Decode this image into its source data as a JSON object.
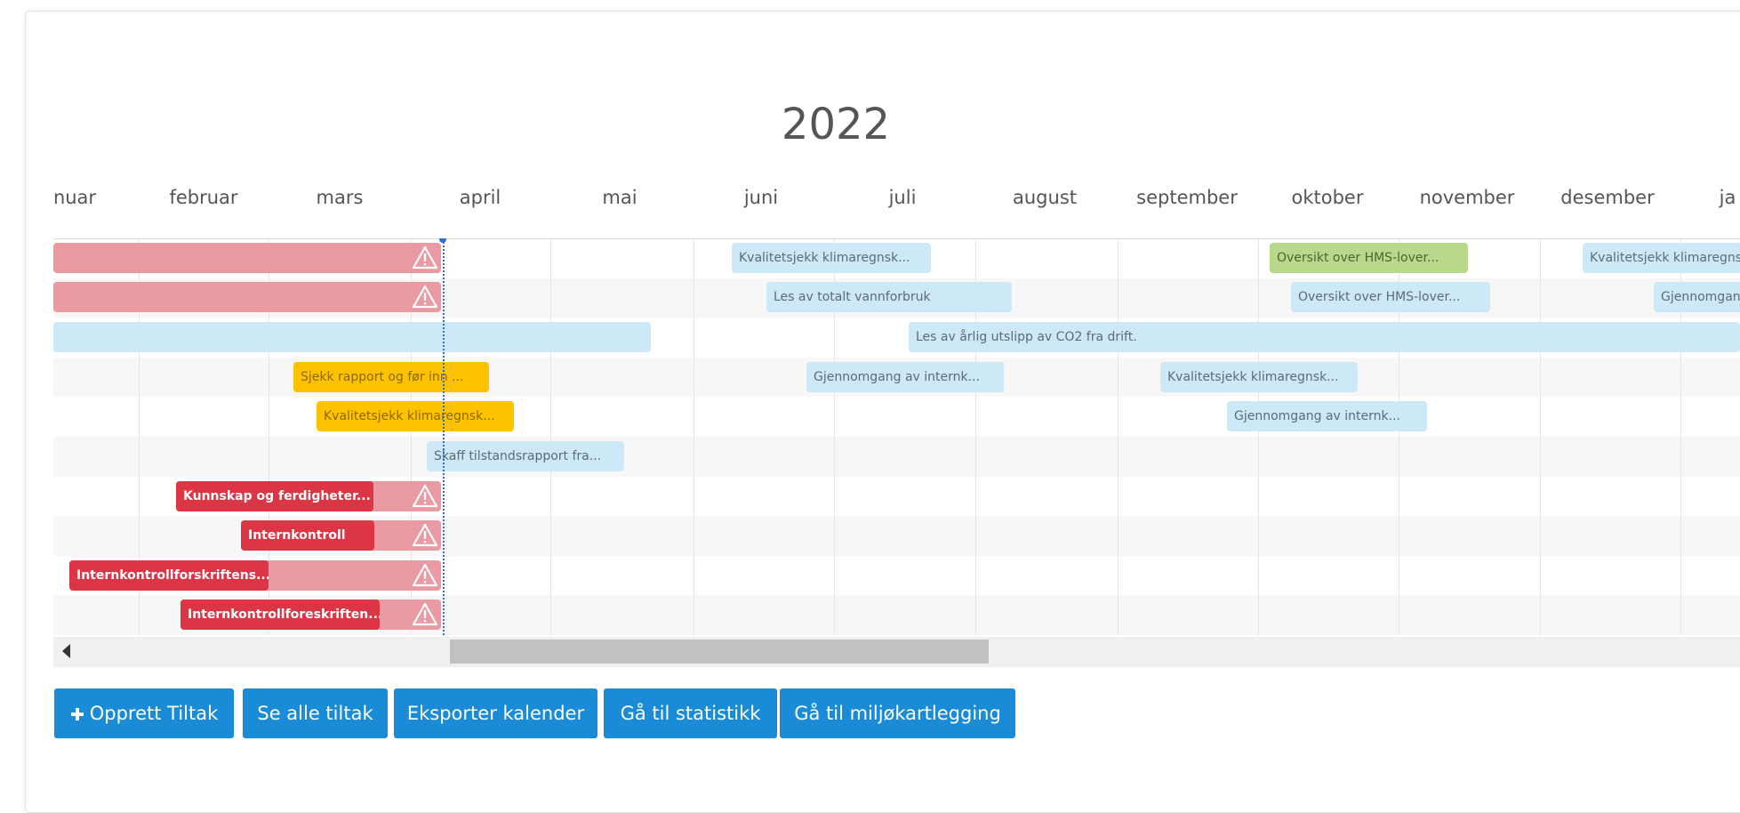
{
  "calendar": {
    "year": "2022",
    "months": [
      "nuar",
      "februar",
      "mars",
      "april",
      "mai",
      "juni",
      "juli",
      "august",
      "september",
      "oktober",
      "november",
      "desember",
      "ja"
    ]
  },
  "events": [
    {
      "label": "",
      "color": "overdue",
      "warning": true
    },
    {
      "label": "",
      "color": "overdue",
      "warning": true
    },
    {
      "label": "",
      "color": "light",
      "warning": false
    },
    {
      "label": "Sjekk rapport og før inn ...",
      "color": "orange",
      "warning": false
    },
    {
      "label": "Kvalitetsjekk klimaregnsk...",
      "color": "orange",
      "warning": false
    },
    {
      "label": "Skaff tilstandsrapport fra...",
      "color": "light",
      "warning": false
    },
    {
      "label": "Kunnskap og ferdigheter...",
      "color": "darkred",
      "warning": true
    },
    {
      "label": "Internkontroll",
      "color": "darkred",
      "warning": true
    },
    {
      "label": "Internkontrollforskriftens...",
      "color": "darkred",
      "warning": true
    },
    {
      "label": "Internkontrollforeskriften...",
      "color": "darkred",
      "warning": true
    },
    {
      "label": "Kvalitetsjekk klimaregnsk...",
      "color": "light",
      "warning": false
    },
    {
      "label": "Les av totalt vannforbruk",
      "color": "light",
      "warning": false
    },
    {
      "label": "Les av årlig utslipp av CO2 fra drift.",
      "color": "light",
      "warning": false
    },
    {
      "label": "Gjennomgang av internk...",
      "color": "light",
      "warning": false
    },
    {
      "label": "Kvalitetsjekk klimaregnsk...",
      "color": "light",
      "warning": false
    },
    {
      "label": "Gjennomgang av internk...",
      "color": "light",
      "warning": false
    },
    {
      "label": "Oversikt over HMS-lover...",
      "color": "green",
      "warning": false
    },
    {
      "label": "Oversikt over HMS-lover...",
      "color": "light",
      "warning": false
    },
    {
      "label": "Kvalitetsjekk klimaregnsk...",
      "color": "light",
      "warning": false
    },
    {
      "label": "Gjennomgang",
      "color": "light",
      "warning": false
    }
  ],
  "buttons": {
    "create_icon": "plus-icon",
    "create_label": "Opprett Tiltak",
    "see_all_label": "Se alle tiltak",
    "export_label": "Eksporter kalender",
    "statistics_label": "Gå til statistikk",
    "mapping_label": "Gå til miljøkartlegging"
  },
  "colors": {
    "primary_button": "#1a8bd6",
    "overdue": "#ea9aa2",
    "critical": "#dc3545",
    "warning": "#ffc200",
    "done": "#b8d98b",
    "planned": "#cde8f6",
    "today_marker": "#2b6fd6"
  }
}
